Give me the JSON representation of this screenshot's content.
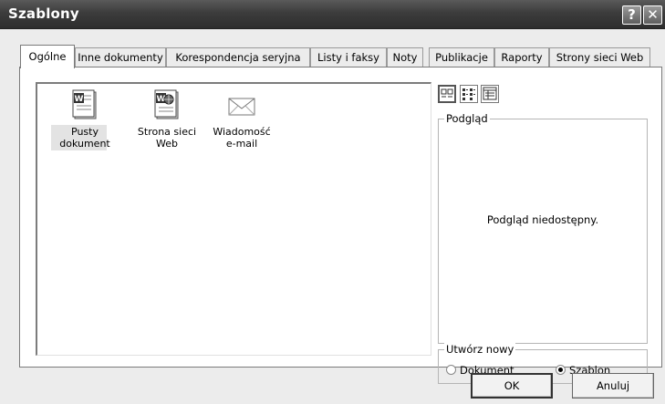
{
  "window": {
    "title": "Szablony",
    "help_label": "?",
    "close_label": "✕"
  },
  "tabs": [
    {
      "label": "Ogólne",
      "active": true
    },
    {
      "label": "Inne dokumenty"
    },
    {
      "label": "Korespondencja seryjna"
    },
    {
      "label": "Listy i faksy"
    },
    {
      "label": "Noty"
    },
    {
      "label": "Publikacje"
    },
    {
      "label": "Raporty"
    },
    {
      "label": "Strony sieci Web"
    }
  ],
  "templates": [
    {
      "line1": "Pusty",
      "line2": "dokument",
      "icon": "word-document-icon",
      "selected": true
    },
    {
      "line1": "Strona sieci",
      "line2": "Web",
      "icon": "web-page-icon"
    },
    {
      "line1": "Wiadomość",
      "line2": "e-mail",
      "icon": "envelope-icon"
    }
  ],
  "view_buttons": [
    "large-icons-view-icon",
    "list-view-icon",
    "details-view-icon"
  ],
  "preview": {
    "label": "Podgląd",
    "text": "Podgląd niedostępny."
  },
  "create_new": {
    "label": "Utwórz nowy",
    "options": [
      {
        "label": "Dokument",
        "selected": false
      },
      {
        "label": "Szablon",
        "selected": true
      }
    ]
  },
  "buttons": {
    "ok": "OK",
    "cancel": "Anuluj"
  }
}
